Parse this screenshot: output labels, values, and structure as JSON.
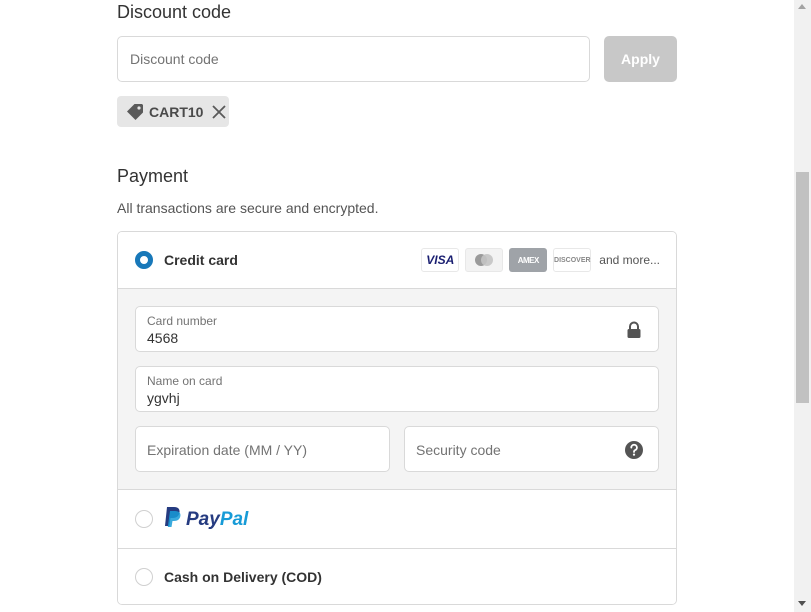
{
  "discount": {
    "title": "Discount code",
    "placeholder": "Discount code",
    "apply_label": "Apply",
    "applied_code": "CART10"
  },
  "payment": {
    "title": "Payment",
    "subtitle": "All transactions are secure and encrypted.",
    "credit_card": {
      "label": "Credit card",
      "selected": true,
      "card_brands": [
        "VISA",
        "AMEX",
        "DISCOVER"
      ],
      "more_label": "and more...",
      "fields": {
        "card_number": {
          "label": "Card number",
          "value": "4568"
        },
        "name_on_card": {
          "label": "Name on card",
          "value": "ygvhj"
        },
        "expiration": {
          "placeholder": "Expiration date (MM / YY)"
        },
        "security_code": {
          "placeholder": "Security code"
        }
      }
    },
    "paypal": {
      "logo_part1": "Pay",
      "logo_part2": "Pal"
    },
    "cod": {
      "label": "Cash on Delivery (COD)"
    }
  },
  "colors": {
    "accent": "#1878b9",
    "apply_disabled": "#c8c8c8",
    "paypal_dark": "#253b80",
    "paypal_light": "#179bd7"
  }
}
